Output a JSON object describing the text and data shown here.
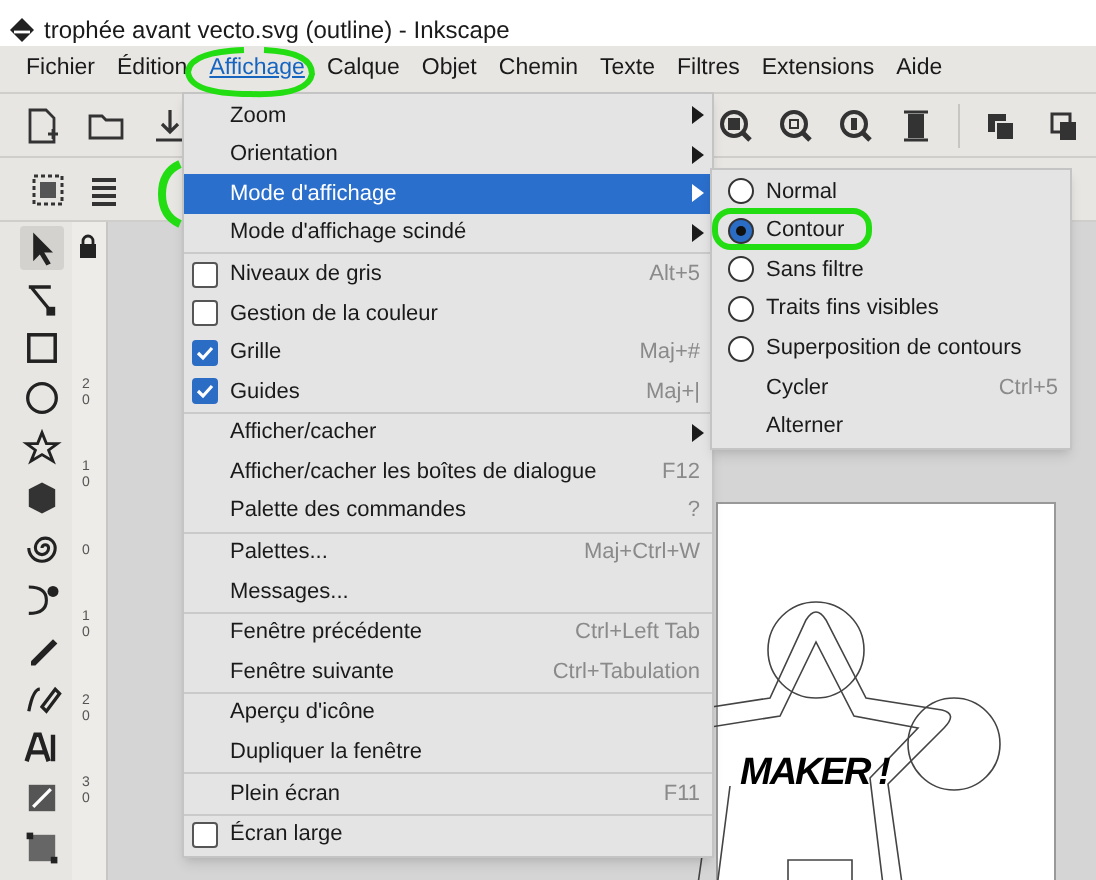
{
  "window": {
    "title": "trophée avant vecto.svg (outline) - Inkscape"
  },
  "menubar": [
    {
      "label": "Fichier",
      "selected": false
    },
    {
      "label": "Édition",
      "selected": false
    },
    {
      "label": "Affichage",
      "selected": true
    },
    {
      "label": "Calque",
      "selected": false
    },
    {
      "label": "Objet",
      "selected": false
    },
    {
      "label": "Chemin",
      "selected": false
    },
    {
      "label": "Texte",
      "selected": false
    },
    {
      "label": "Filtres",
      "selected": false
    },
    {
      "label": "Extensions",
      "selected": false
    },
    {
      "label": "Aide",
      "selected": false
    }
  ],
  "ruler": {
    "labels": [
      "20",
      "10",
      "0",
      "10",
      "20",
      "30"
    ]
  },
  "menu": {
    "sections": [
      [
        {
          "kind": "submenu",
          "label": "Zoom",
          "selected": false
        },
        {
          "kind": "submenu",
          "label": "Orientation",
          "selected": false
        },
        {
          "kind": "submenu",
          "label": "Mode d'affichage",
          "selected": true
        },
        {
          "kind": "submenu",
          "label": "Mode d'affichage scindé",
          "selected": false
        }
      ],
      [
        {
          "kind": "check",
          "label": "Niveaux de gris",
          "checked": false,
          "shortcut": "Alt+5"
        },
        {
          "kind": "check",
          "label": "Gestion de la couleur",
          "checked": false
        },
        {
          "kind": "check",
          "label": "Grille",
          "checked": true,
          "shortcut": "Maj+#"
        },
        {
          "kind": "check",
          "label": "Guides",
          "checked": true,
          "shortcut": "Maj+|"
        }
      ],
      [
        {
          "kind": "submenu",
          "label": "Afficher/cacher",
          "selected": false
        },
        {
          "kind": "plain",
          "label": "Afficher/cacher les boîtes de dialogue",
          "shortcut": "F12"
        },
        {
          "kind": "plain",
          "label": "Palette des commandes",
          "shortcut": "?"
        }
      ],
      [
        {
          "kind": "plain",
          "label": "Palettes...",
          "shortcut": "Maj+Ctrl+W"
        },
        {
          "kind": "plain",
          "label": "Messages..."
        }
      ],
      [
        {
          "kind": "plain",
          "label": "Fenêtre précédente",
          "shortcut": "Ctrl+Left Tab"
        },
        {
          "kind": "plain",
          "label": "Fenêtre suivante",
          "shortcut": "Ctrl+Tabulation"
        }
      ],
      [
        {
          "kind": "plain",
          "label": "Aperçu d'icône"
        },
        {
          "kind": "plain",
          "label": "Dupliquer la fenêtre"
        }
      ],
      [
        {
          "kind": "plain",
          "label": "Plein écran",
          "shortcut": "F11"
        }
      ],
      [
        {
          "kind": "check",
          "label": "Écran large",
          "checked": false
        }
      ]
    ]
  },
  "submenu": {
    "items": [
      {
        "kind": "radio",
        "label": "Normal",
        "selected": false
      },
      {
        "kind": "radio",
        "label": "Contour",
        "selected": true
      },
      {
        "kind": "radio",
        "label": "Sans filtre",
        "selected": false
      },
      {
        "kind": "radio",
        "label": "Traits fins visibles",
        "selected": false
      },
      {
        "kind": "radio",
        "label": "Superposition de contours",
        "selected": false
      },
      {
        "kind": "plain",
        "label": "Cycler",
        "shortcut": "Ctrl+5"
      },
      {
        "kind": "plain",
        "label": "Alterner"
      }
    ]
  },
  "canvas": {
    "text": "MAKER !"
  }
}
